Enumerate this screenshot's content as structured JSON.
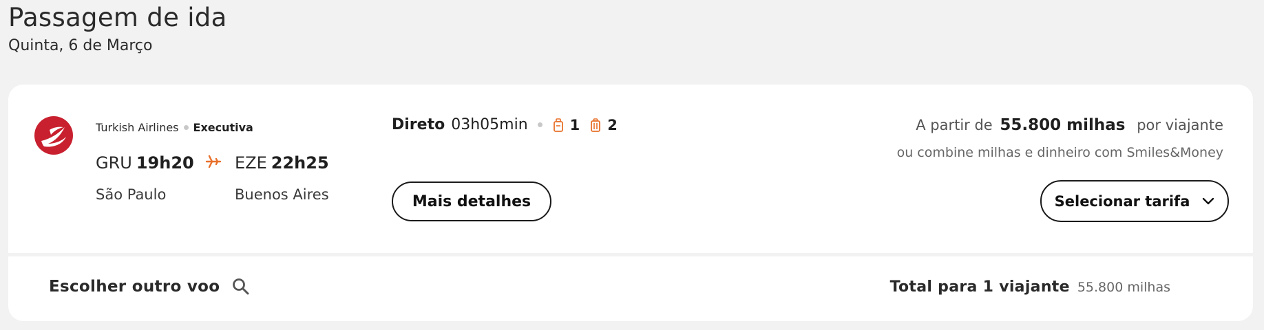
{
  "header": {
    "title": "Passagem de ida",
    "date": "Quinta, 6 de Março"
  },
  "flight": {
    "airline": "Turkish Airlines",
    "cabin": "Executiva",
    "origin_code": "GRU",
    "departure_time": "19h20",
    "origin_city": "São Paulo",
    "destination_code": "EZE",
    "arrival_time": "22h25",
    "destination_city": "Buenos Aires",
    "stops_label": "Direto",
    "duration": "03h05min",
    "carry_on_count": "1",
    "checked_bag_count": "2",
    "details_button": "Mais detalhes"
  },
  "pricing": {
    "prefix": "A partir de",
    "miles": "55.800 milhas",
    "suffix": "por viajante",
    "combine_text": "ou combine milhas e dinheiro com Smiles&Money",
    "select_button": "Selecionar tarifa"
  },
  "footer": {
    "choose_other": "Escolher outro voo",
    "total_label": "Total para 1 viajante",
    "total_amount": "55.800 milhas"
  },
  "colors": {
    "accent": "#e8702a",
    "brand_red": "#c8202f",
    "background": "#f2f2f2"
  },
  "icons": [
    "turkish-airlines-logo",
    "plane-icon",
    "carry-on-bag-icon",
    "checked-bag-icon",
    "chevron-down-icon",
    "search-icon"
  ]
}
